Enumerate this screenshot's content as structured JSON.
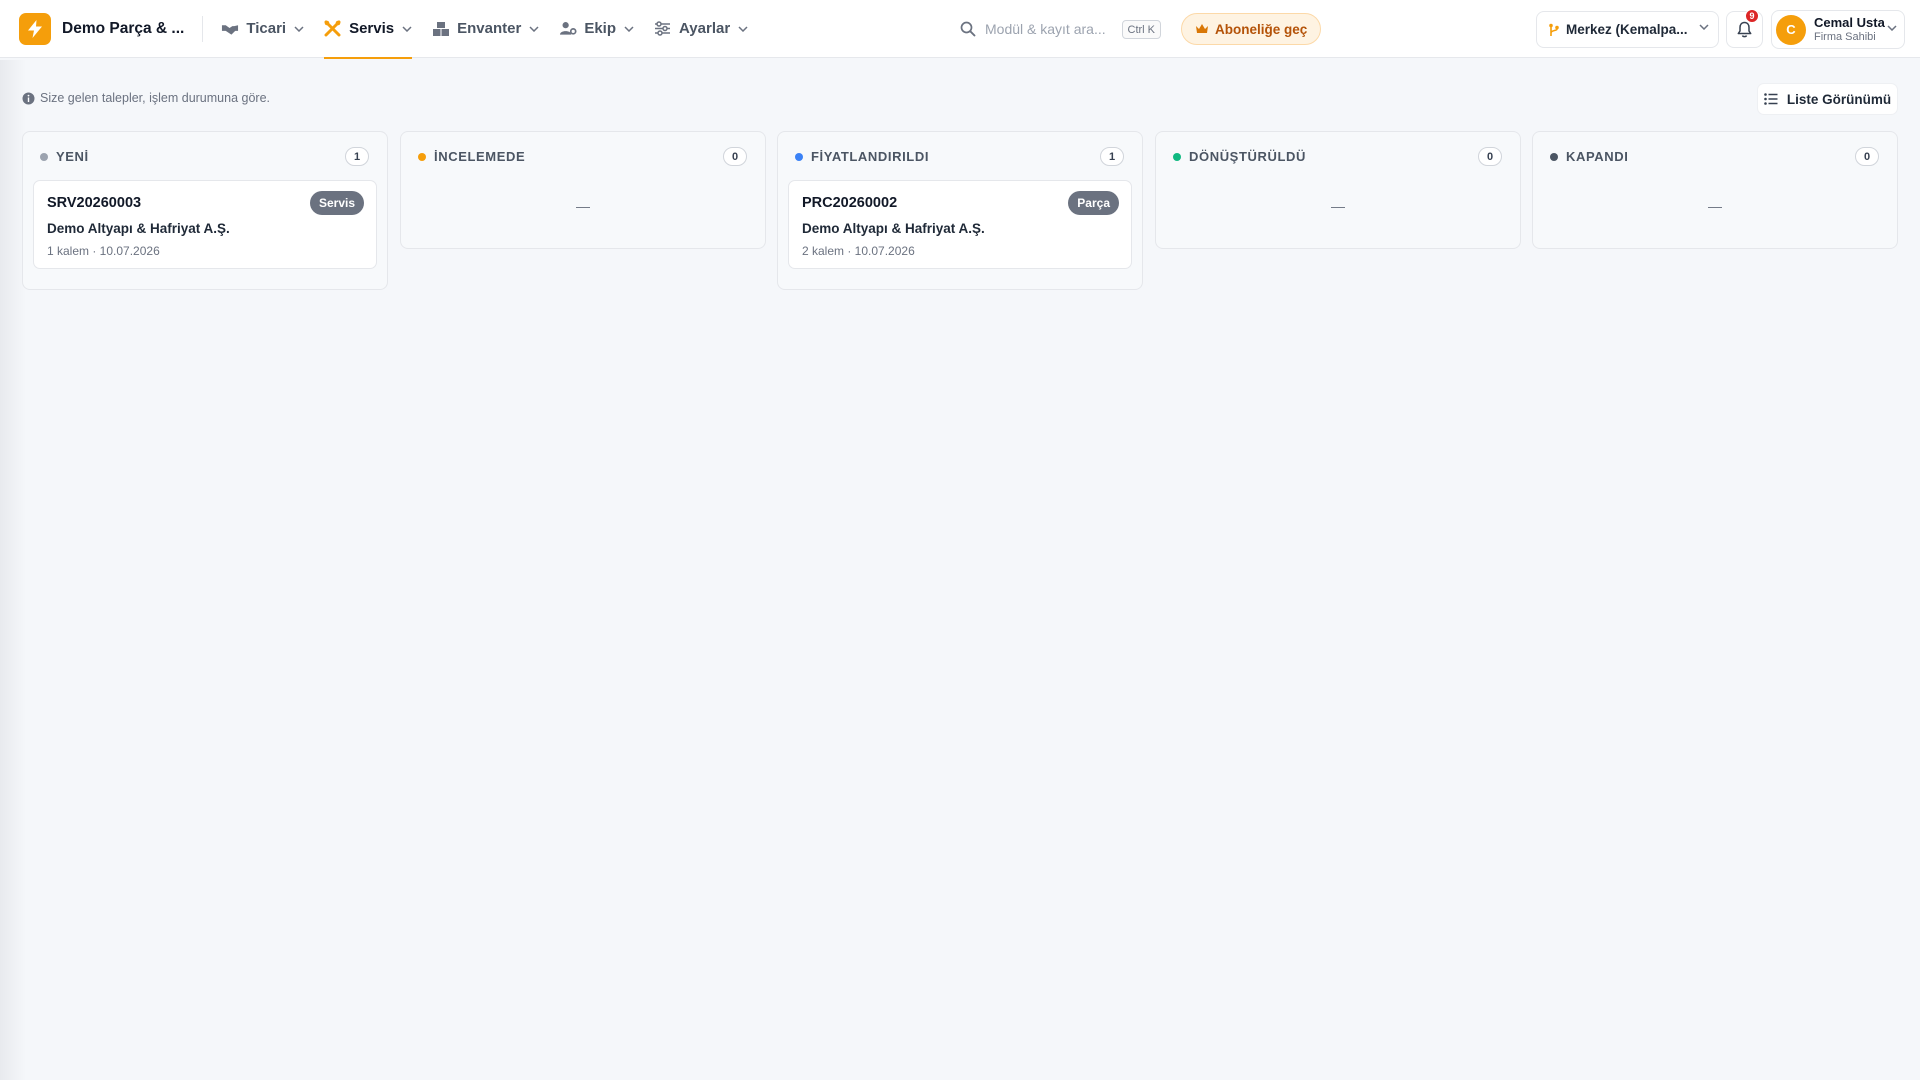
{
  "brand": {
    "name": "Demo Parça & ..."
  },
  "nav": {
    "items": [
      {
        "label": "Ticari",
        "icon": "handshake-icon",
        "active": false
      },
      {
        "label": "Servis",
        "icon": "tools-icon",
        "active": true
      },
      {
        "label": "Envanter",
        "icon": "boxes-icon",
        "active": false
      },
      {
        "label": "Ekip",
        "icon": "users-gear-icon",
        "active": false
      },
      {
        "label": "Ayarlar",
        "icon": "sliders-icon",
        "active": false
      }
    ]
  },
  "search": {
    "placeholder": "Modül & kayıt ara...",
    "shortcut": "Ctrl K"
  },
  "subscribe": {
    "label": "Aboneliğe geç"
  },
  "branch": {
    "label": "Merkez (Kemalpa..."
  },
  "notifications": {
    "count": "9"
  },
  "user": {
    "initial": "C",
    "name": "Cemal Usta",
    "role": "Firma Sahibi"
  },
  "info": {
    "text": "Size gelen talepler, işlem durumuna göre."
  },
  "view_toggle": {
    "label": "Liste Görünümü"
  },
  "colors": {
    "accent": "#f59e0b",
    "yeni": "#9ca3af",
    "incelemede": "#f59e0b",
    "fiyatlandirildi": "#3b82f6",
    "donusturuldu": "#10b981",
    "kapandi": "#4b5563"
  },
  "columns": [
    {
      "title": "YENİ",
      "count": "1",
      "color": "#9ca3af",
      "cards": [
        {
          "code": "SRV20260003",
          "badge": "Servis",
          "customer": "Demo Altyapı & Hafriyat A.Ş.",
          "meta": "1 kalem · 10.07.2026"
        }
      ],
      "empty": ""
    },
    {
      "title": "İNCELEMEDE",
      "count": "0",
      "color": "#f59e0b",
      "cards": [],
      "empty": "—"
    },
    {
      "title": "FİYATLANDIRILDI",
      "count": "1",
      "color": "#3b82f6",
      "cards": [
        {
          "code": "PRC20260002",
          "badge": "Parça",
          "customer": "Demo Altyapı & Hafriyat A.Ş.",
          "meta": "2 kalem · 10.07.2026"
        }
      ],
      "empty": ""
    },
    {
      "title": "DÖNÜŞTÜRÜLDÜ",
      "count": "0",
      "color": "#10b981",
      "cards": [],
      "empty": "—"
    },
    {
      "title": "KAPANDI",
      "count": "0",
      "color": "#4b5563",
      "cards": [],
      "empty": "—"
    }
  ]
}
